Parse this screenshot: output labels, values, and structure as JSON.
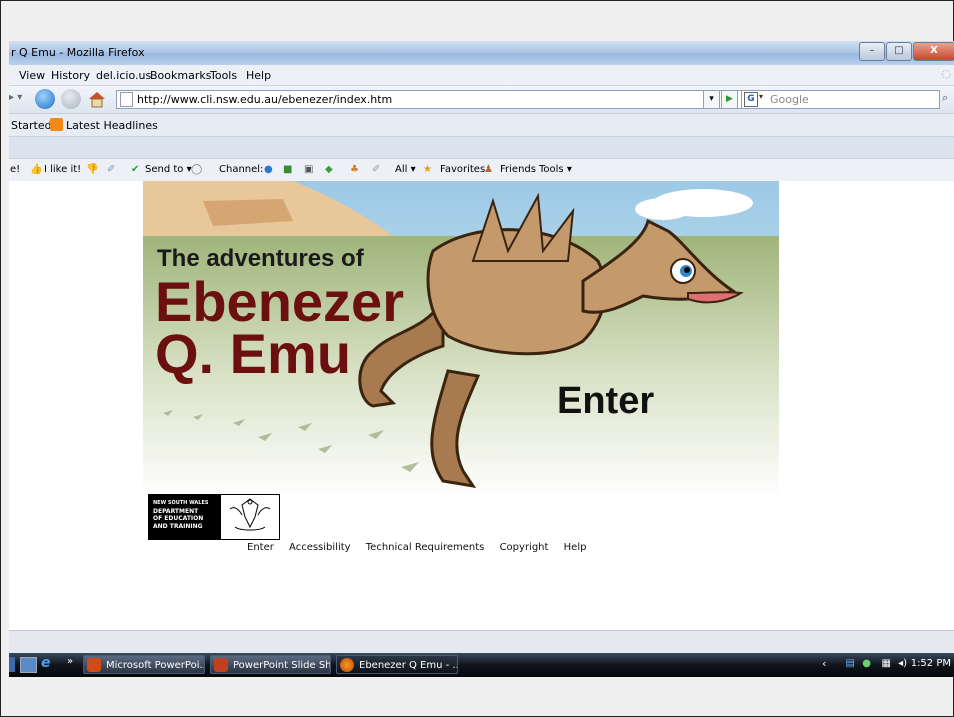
{
  "window": {
    "title": "r Q Emu - Mozilla Firefox",
    "controls": [
      "–",
      "□",
      "X"
    ]
  },
  "menu": {
    "view": "View",
    "history": "History",
    "delicious": "del.icio.us",
    "bookmarks": "Bookmarks",
    "tools": "Tools",
    "help": "Help"
  },
  "nav": {
    "url": "http://www.cli.nsw.edu.au/ebenezer/index.htm",
    "search_placeholder": "Google"
  },
  "bookmarks_bar": {
    "getting_started": "Started",
    "latest_headlines": "Latest Headlines"
  },
  "toolbar": {
    "e": "e!",
    "i_like_it": "I like it!",
    "send_to": "Send to ▾",
    "channel": "Channel:",
    "all": "All ▾",
    "favorites": "Favorites",
    "friends": "Friends",
    "tools": "Tools ▾"
  },
  "page": {
    "heading_small": "The adventures of",
    "heading_line1": "Ebenezer",
    "heading_line2": "Q. Emu",
    "enter_big": "Enter",
    "logo_text": [
      "NEW SOUTH WALES",
      "DEPARTMENT",
      "OF EDUCATION",
      "AND TRAINING"
    ],
    "links": [
      "Enter",
      "Accessibility",
      "Technical Requirements",
      "Copyright",
      "Help"
    ]
  },
  "taskbar": {
    "overflow": "»",
    "tasks": [
      "Microsoft PowerPoi...",
      "PowerPoint Slide Sh...",
      "Ebenezer Q Emu - ..."
    ],
    "clock": "1:52 PM",
    "tray_back": "‹"
  },
  "colors": {
    "title_red": "#6b0f0f",
    "sky": "#cfe6f5",
    "grass": "#b8c79a",
    "emu_body": "#c49a6c"
  }
}
